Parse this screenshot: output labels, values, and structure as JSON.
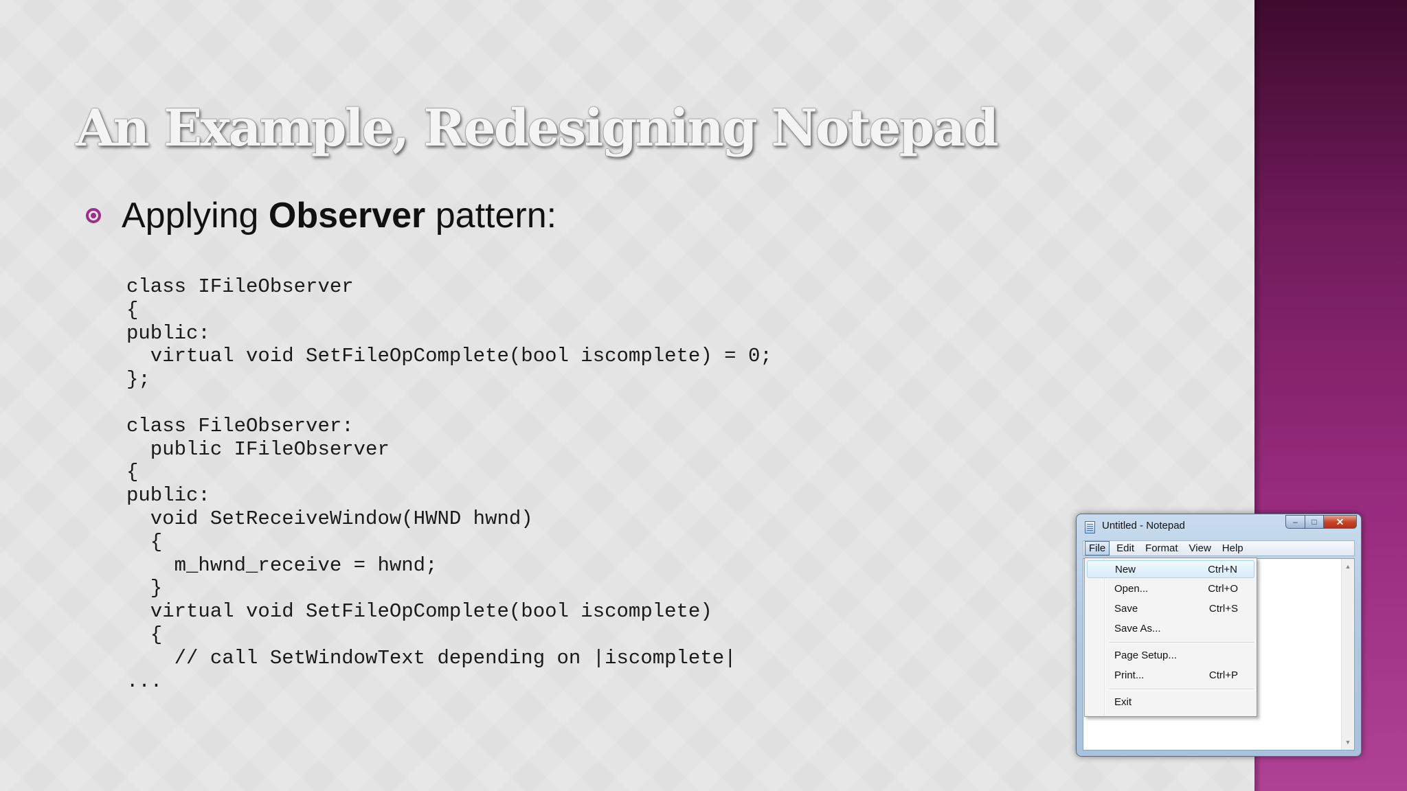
{
  "slide": {
    "title": "An Example, Redesigning Notepad",
    "bullet": {
      "prefix": "Applying ",
      "emphasis": "Observer",
      "suffix": " pattern:"
    },
    "code_lines": [
      "class IFileObserver",
      "{",
      "public:",
      "  virtual void SetFileOpComplete(bool iscomplete) = 0;",
      "};",
      "",
      "class FileObserver:",
      "  public IFileObserver",
      "{",
      "public:",
      "  void SetReceiveWindow(HWND hwnd)",
      "  {",
      "    m_hwnd_receive = hwnd;",
      "  }",
      "  virtual void SetFileOpComplete(bool iscomplete)",
      "  {",
      "    // call SetWindowText depending on |iscomplete|",
      "..."
    ],
    "colors": {
      "accent": "#9e2d8d",
      "side_bar_top": "#3e0a2e",
      "side_bar_bottom": "#b04296"
    }
  },
  "notepad": {
    "window_title": "Untitled - Notepad",
    "controls": {
      "minimize": "–",
      "maximize": "□",
      "close": "✕"
    },
    "menubar": {
      "file": "File",
      "edit": "Edit",
      "format": "Format",
      "view": "View",
      "help": "Help"
    },
    "file_menu": {
      "new": {
        "label": "New",
        "shortcut": "Ctrl+N"
      },
      "open": {
        "label": "Open...",
        "shortcut": "Ctrl+O"
      },
      "save": {
        "label": "Save",
        "shortcut": "Ctrl+S"
      },
      "save_as": {
        "label": "Save As..."
      },
      "page_setup": {
        "label": "Page Setup..."
      },
      "print": {
        "label": "Print...",
        "shortcut": "Ctrl+P"
      },
      "exit": {
        "label": "Exit"
      }
    },
    "scrollbar": {
      "up": "▲",
      "down": "▼"
    },
    "icons": [
      "notepad-icon",
      "minimize-icon",
      "maximize-icon",
      "close-icon",
      "scroll-up-arrow-icon",
      "scroll-down-arrow-icon"
    ]
  }
}
